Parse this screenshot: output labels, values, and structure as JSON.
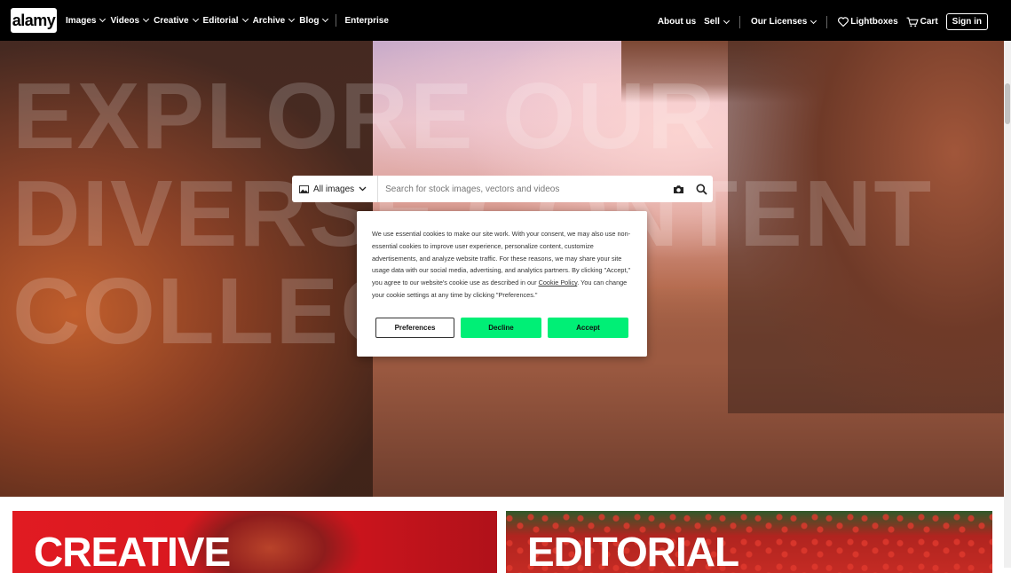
{
  "header": {
    "logo": "alamy",
    "nav_left": [
      {
        "label": "Images",
        "dropdown": true
      },
      {
        "label": "Videos",
        "dropdown": true
      },
      {
        "label": "Creative",
        "dropdown": true
      },
      {
        "label": "Editorial",
        "dropdown": true
      },
      {
        "label": "Archive",
        "dropdown": true
      },
      {
        "label": "Blog",
        "dropdown": true
      },
      {
        "label": "Enterprise",
        "dropdown": false
      }
    ],
    "nav_right": {
      "about": "About us",
      "sell": "Sell",
      "licenses": "Our Licenses",
      "lightboxes": "Lightboxes",
      "cart": "Cart",
      "signin": "Sign in"
    }
  },
  "hero": {
    "background_text": [
      "EXPLORE OUR",
      "DIVERSE CONTENT",
      "COLLECTION"
    ],
    "search": {
      "type_label": "All images",
      "placeholder": "Search for stock images, vectors and videos"
    }
  },
  "cookie_banner": {
    "text_before_link": "We use essential cookies to make our site work. With your consent, we may also use non-essential cookies to improve user experience, personalize content, customize advertisements, and analyze website traffic. For these reasons, we may share your site usage data with our social media, advertising, and analytics partners. By clicking \"Accept,\" you agree to our website's cookie use as described in our ",
    "link_text": "Cookie Policy",
    "text_after_link": ". You can change your cookie settings at any time by clicking \"Preferences.\"",
    "buttons": {
      "preferences": "Preferences",
      "decline": "Decline",
      "accept": "Accept"
    }
  },
  "cards": {
    "creative_title": "CREATIVE",
    "editorial_title": "EDITORIAL"
  },
  "colors": {
    "accent_green": "#00ef76",
    "creative_red": "#e11b22",
    "topbar_black": "#000000"
  }
}
